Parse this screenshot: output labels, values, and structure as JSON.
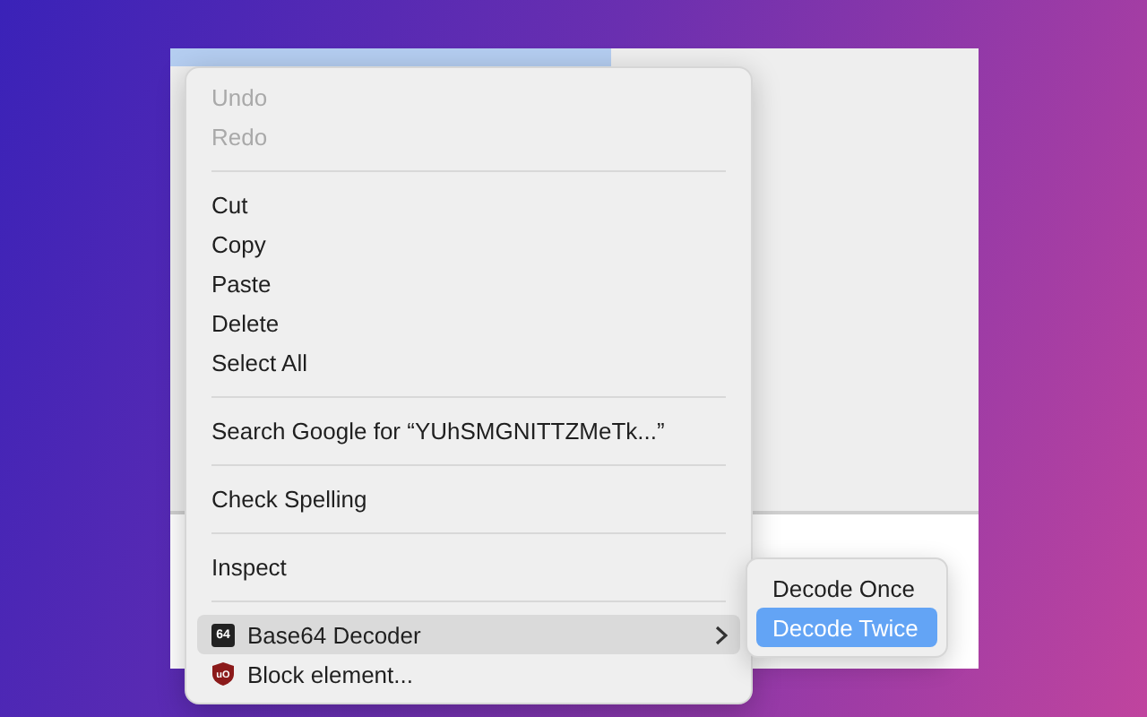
{
  "context_menu": {
    "items": [
      {
        "kind": "item",
        "label": "Undo",
        "disabled": true,
        "selected": false
      },
      {
        "kind": "item",
        "label": "Redo",
        "disabled": true,
        "selected": false
      },
      {
        "kind": "separator"
      },
      {
        "kind": "item",
        "label": "Cut",
        "disabled": false,
        "selected": false
      },
      {
        "kind": "item",
        "label": "Copy",
        "disabled": false,
        "selected": false
      },
      {
        "kind": "item",
        "label": "Paste",
        "disabled": false,
        "selected": false
      },
      {
        "kind": "item",
        "label": "Delete",
        "disabled": false,
        "selected": false
      },
      {
        "kind": "item",
        "label": "Select All",
        "disabled": false,
        "selected": false
      },
      {
        "kind": "separator"
      },
      {
        "kind": "item",
        "label": "Search Google for “YUhSMGNITTZMeTk...”",
        "disabled": false,
        "selected": false
      },
      {
        "kind": "separator"
      },
      {
        "kind": "item",
        "label": "Check Spelling",
        "disabled": false,
        "selected": false
      },
      {
        "kind": "separator"
      },
      {
        "kind": "item",
        "label": "Inspect",
        "disabled": false,
        "selected": false
      },
      {
        "kind": "separator"
      },
      {
        "kind": "decoder",
        "icon_text": "64",
        "label": "Base64 Decoder",
        "disabled": false,
        "selected": true,
        "submenu": true
      },
      {
        "kind": "blocker",
        "icon_text": "uO",
        "label": "Block element...",
        "disabled": false,
        "selected": false,
        "submenu": false
      }
    ]
  },
  "submenu": {
    "items": [
      {
        "label": "Decode Once",
        "selected": false
      },
      {
        "label": "Decode Twice",
        "selected": true
      }
    ]
  }
}
